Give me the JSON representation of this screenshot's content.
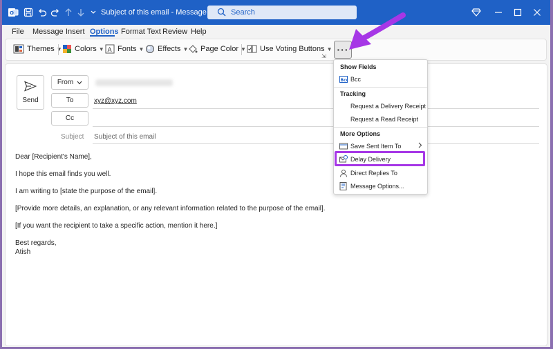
{
  "titlebar": {
    "title": "Subject of this email  -  Message (HT...",
    "search_placeholder": "Search",
    "icons": [
      "outlook-icon",
      "save-icon",
      "undo-icon",
      "redo-icon",
      "up-arrow-icon",
      "down-arrow-icon",
      "diamond-icon",
      "minimize-icon",
      "maximize-icon",
      "close-icon"
    ]
  },
  "menu": {
    "items": [
      "File",
      "Message",
      "Insert",
      "Options",
      "Format Text",
      "Review",
      "Help"
    ],
    "active": "Options"
  },
  "ribbon": {
    "themes": "Themes",
    "colors": "Colors",
    "fonts": "Fonts",
    "effects": "Effects",
    "page_color": "Page Color",
    "voting": "Use Voting Buttons",
    "more": "···"
  },
  "compose": {
    "send_label": "Send",
    "from_label": "From",
    "to_label": "To",
    "cc_label": "Cc",
    "to_value": "xyz@xyz.com",
    "subject_label": "Subject",
    "subject_value": "Subject of this email",
    "body": [
      "Dear [Recipient's Name],",
      "I hope this email finds you well.",
      "I am writing to [state the purpose of the email].",
      "[Provide more details, an explanation, or any relevant information related to the purpose of the email].",
      "[If you want the recipient to take a specific action, mention it here.]",
      "Best regards,",
      "Atish"
    ]
  },
  "dropdown": {
    "show_fields": "Show Fields",
    "bcc": "Bcc",
    "tracking": "Tracking",
    "delivery_receipt": "Request a Delivery Receipt",
    "read_receipt": "Request a Read Receipt",
    "more_options": "More Options",
    "save_sent": "Save Sent Item To",
    "delay_delivery": "Delay Delivery",
    "direct_replies": "Direct Replies To",
    "message_options": "Message Options..."
  },
  "colors": {
    "title_bar": "#1f61c6",
    "highlight": "#a637e6",
    "arrow": "#a637e6"
  }
}
